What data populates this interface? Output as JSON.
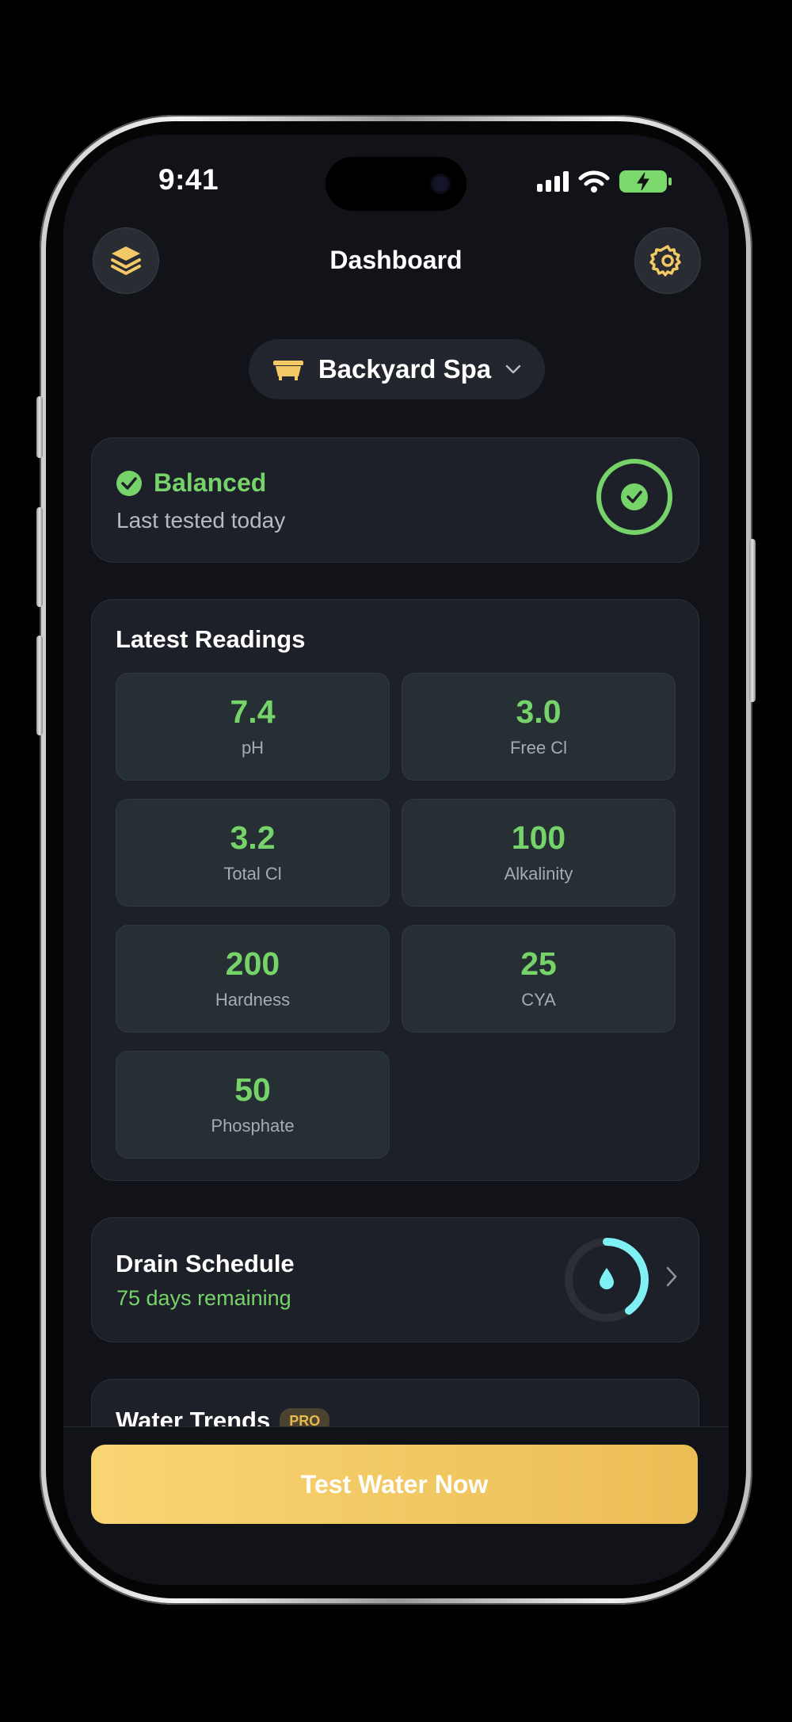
{
  "status_bar": {
    "time": "9:41"
  },
  "header": {
    "title": "Dashboard"
  },
  "spa_selector": {
    "selected": "Backyard Spa"
  },
  "status_card": {
    "status": "Balanced",
    "subtitle": "Last tested today"
  },
  "readings": {
    "title": "Latest Readings",
    "items": [
      {
        "value": "7.4",
        "label": "pH"
      },
      {
        "value": "3.0",
        "label": "Free Cl"
      },
      {
        "value": "3.2",
        "label": "Total Cl"
      },
      {
        "value": "100",
        "label": "Alkalinity"
      },
      {
        "value": "200",
        "label": "Hardness"
      },
      {
        "value": "25",
        "label": "CYA"
      },
      {
        "value": "50",
        "label": "Phosphate"
      }
    ]
  },
  "drain": {
    "title": "Drain Schedule",
    "subtitle": "75 days remaining",
    "progress_fraction": 0.4
  },
  "trends": {
    "title": "Water Trends",
    "badge": "PRO"
  },
  "cta": {
    "label": "Test Water Now"
  },
  "colors": {
    "accent_green": "#76d36a",
    "accent_gold": "#f3c965",
    "drain_cyan": "#7ff0f4",
    "background": "#111318"
  }
}
